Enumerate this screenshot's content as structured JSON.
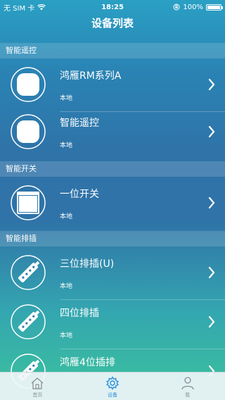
{
  "status": {
    "carrier": "无 SIM 卡",
    "time": "18:25",
    "battery": "100%"
  },
  "nav": {
    "title": "设备列表"
  },
  "sections": [
    {
      "header": "智能遥控",
      "rows": [
        {
          "title": "鸿雁RM系列A",
          "sub": "本地",
          "icon": "rm-remote-icon"
        },
        {
          "title": "智能遥控",
          "sub": "本地",
          "icon": "rm-remote-icon"
        }
      ]
    },
    {
      "header": "智能开关",
      "rows": [
        {
          "title": "一位开关",
          "sub": "本地",
          "icon": "switch-panel-icon"
        }
      ]
    },
    {
      "header": "智能排插",
      "rows": [
        {
          "title": "三位排插(U)",
          "sub": "本地",
          "icon": "power-strip-icon"
        },
        {
          "title": "四位排插",
          "sub": "本地",
          "icon": "power-strip-icon"
        },
        {
          "title": "鸿雁4位插排",
          "sub": "",
          "icon": "power-strip-icon"
        }
      ]
    }
  ],
  "tabs": [
    {
      "label": "首页",
      "icon": "home-icon",
      "active": false
    },
    {
      "label": "设备",
      "icon": "gear-icon",
      "active": true
    },
    {
      "label": "我",
      "icon": "user-icon",
      "active": false
    }
  ],
  "colors": {
    "accent": "#2a8fe0",
    "tab_inactive": "#8a8f93"
  }
}
